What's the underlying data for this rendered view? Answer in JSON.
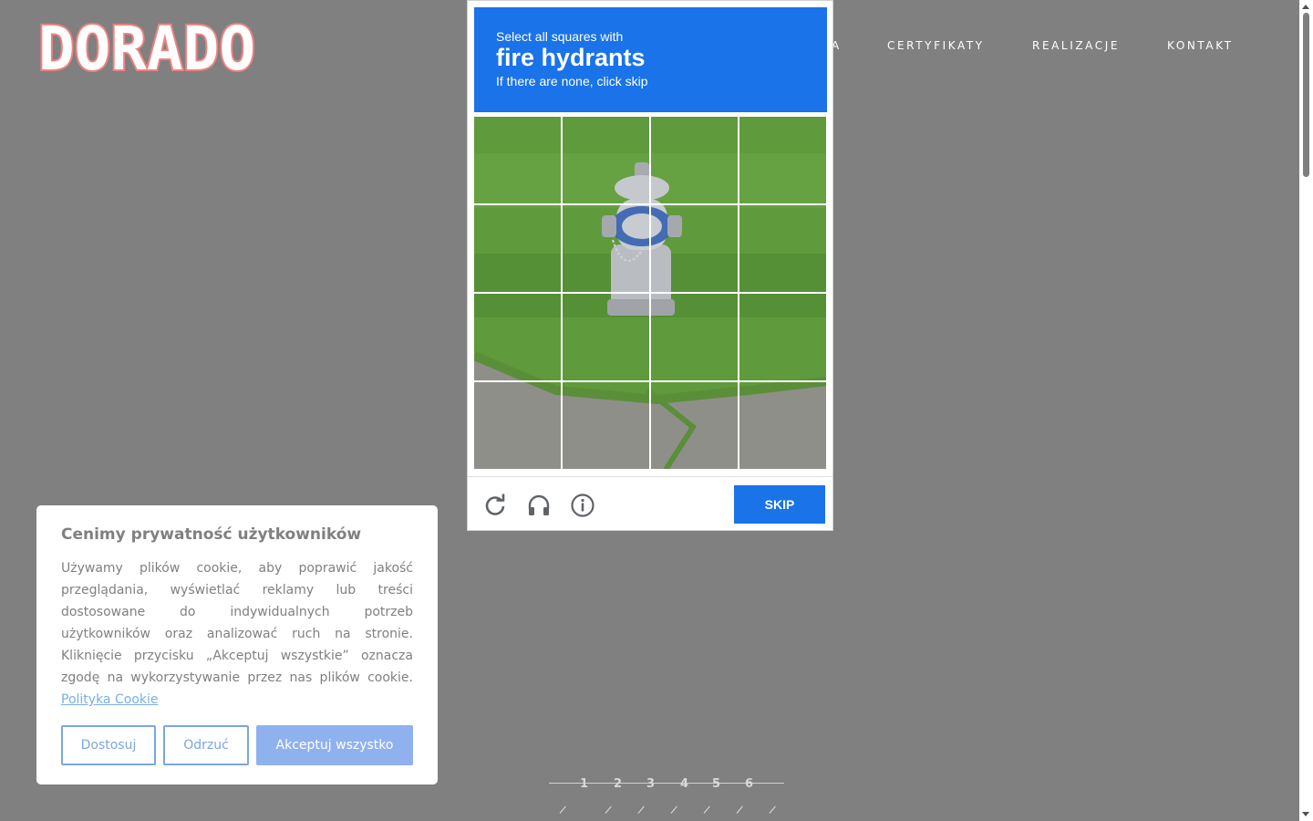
{
  "logo": {
    "text": "DORADO"
  },
  "nav": {
    "items": [
      {
        "label": "A"
      },
      {
        "label": "CERTYFIKATY"
      },
      {
        "label": "REALIZACJE"
      },
      {
        "label": "KONTAKT"
      }
    ]
  },
  "captcha": {
    "line1": "Select all squares with",
    "target": "fire hydrants",
    "line3": "If there are none, click skip",
    "grid": {
      "rows": 4,
      "cols": 4
    },
    "icons": [
      "reload-icon",
      "headphones-icon",
      "info-icon"
    ],
    "skip_label": "SKIP",
    "accent": "#1a73e8"
  },
  "cookie": {
    "title": "Cenimy prywatność użytkowników",
    "body": "Używamy plików cookie, aby poprawić jakość przeglądania, wyświetlać reklamy lub treści dostosowane do indywidualnych potrzeb użytkowników oraz analizować ruch na stronie. Kliknięcie przycisku „Akceptuj wszystkie” oznacza zgodę na wykorzystywanie przez nas plików cookie.",
    "link": "Polityka Cookie",
    "buttons": {
      "customize": "Dostosuj",
      "reject": "Odrzuć",
      "accept": "Akceptuj wszystko"
    }
  },
  "pager": {
    "pages": [
      "1",
      "2",
      "3",
      "4",
      "5",
      "6"
    ]
  },
  "colors": {
    "overlay": "#808080",
    "logo": "#f08080",
    "button": "#8fb2ee"
  }
}
